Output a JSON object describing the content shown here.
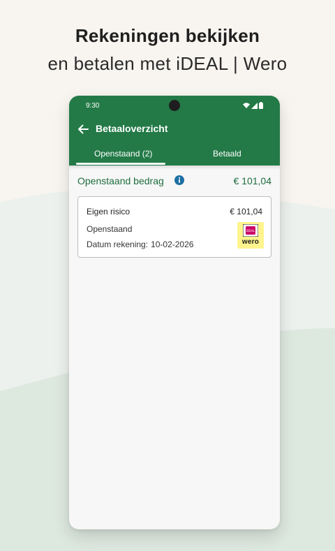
{
  "promo": {
    "headline": "Rekeningen bekijken",
    "subheadline": "en betalen met iDEAL | Wero"
  },
  "status_bar": {
    "time": "9:30"
  },
  "appbar": {
    "title": "Betaaloverzicht"
  },
  "tabs": [
    {
      "label": "Openstaand (2)",
      "active": true
    },
    {
      "label": "Betaald",
      "active": false
    }
  ],
  "summary": {
    "label": "Openstaand bedrag",
    "amount": "€ 101,04"
  },
  "invoice": {
    "title": "Eigen risico",
    "amount": "€ 101,04",
    "status": "Openstaand",
    "date_label": "Datum rekening:",
    "date_value": "10-02-2026",
    "logo_text": "wero",
    "logo_badge": "iDEAL"
  },
  "colors": {
    "brand_green": "#237a47",
    "amount_green": "#1f6d3f",
    "info_blue": "#1d6fa3",
    "wero_yellow": "#fff48d",
    "ideal_pink": "#cc0066"
  }
}
